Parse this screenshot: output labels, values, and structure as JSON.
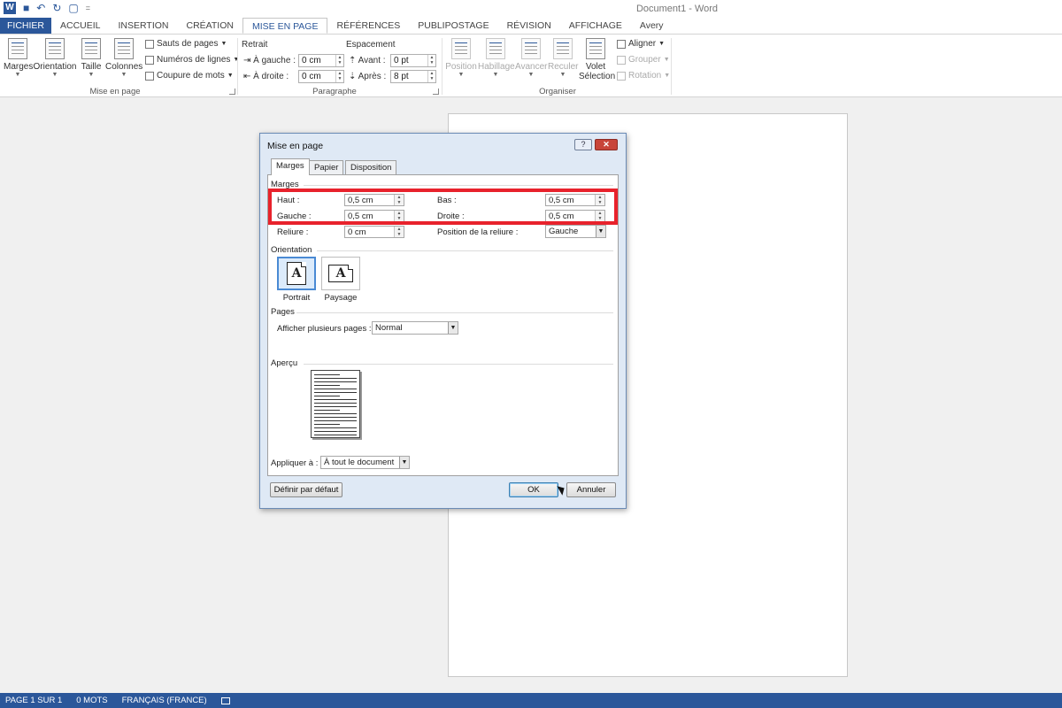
{
  "window": {
    "title": "Document1 - Word",
    "app_logo": "W"
  },
  "quick_access": {
    "save_icon": "save-icon",
    "undo_icon": "undo-icon",
    "redo_icon": "redo-icon",
    "touch_icon": "touch-mode-icon",
    "customize": "="
  },
  "tabs": [
    "FICHIER",
    "ACCUEIL",
    "INSERTION",
    "CRÉATION",
    "MISE EN PAGE",
    "RÉFÉRENCES",
    "PUBLIPOSTAGE",
    "RÉVISION",
    "AFFICHAGE",
    "Avery"
  ],
  "ribbon": {
    "mise_en_page": {
      "label": "Mise en page",
      "marges": "Marges",
      "orientation": "Orientation",
      "taille": "Taille",
      "colonnes": "Colonnes",
      "sauts": "Sauts de pages",
      "numeros": "Numéros de lignes",
      "coupure": "Coupure de mots"
    },
    "paragraphe": {
      "label": "Paragraphe",
      "retrait": "Retrait",
      "espacement": "Espacement",
      "gauche_label": "À gauche :",
      "gauche_value": "0 cm",
      "droite_label": "À droite :",
      "droite_value": "0 cm",
      "avant_label": "Avant :",
      "avant_value": "0 pt",
      "apres_label": "Après :",
      "apres_value": "8 pt"
    },
    "organiser": {
      "label": "Organiser",
      "position": "Position",
      "habillage": "Habillage",
      "avancer": "Avancer",
      "reculer": "Reculer",
      "volet_1": "Volet",
      "volet_2": "Sélection",
      "aligner": "Aligner",
      "grouper": "Grouper",
      "rotation": "Rotation"
    }
  },
  "dialog": {
    "title": "Mise en page",
    "help": "?",
    "close": "✕",
    "tabs": [
      "Marges",
      "Papier",
      "Disposition"
    ],
    "marges_section": "Marges",
    "haut_label": "Haut :",
    "haut_value": "0,5 cm",
    "bas_label": "Bas :",
    "bas_value": "0,5 cm",
    "gauche_label": "Gauche :",
    "gauche_value": "0,5 cm",
    "droite_label": "Droite :",
    "droite_value": "0,5 cm",
    "reliure_label": "Reliure :",
    "reliure_value": "0 cm",
    "position_reliure_label": "Position de la reliure :",
    "position_reliure_value": "Gauche",
    "orientation_section": "Orientation",
    "portrait": "Portrait",
    "paysage": "Paysage",
    "orientation_glyph": "A",
    "pages_section": "Pages",
    "plusieurs_pages_label": "Afficher plusieurs pages :",
    "plusieurs_pages_value": "Normal",
    "apercu_section": "Aperçu",
    "appliquer_label": "Appliquer à :",
    "appliquer_value": "À tout le document",
    "definir_defaut": "Définir par défaut",
    "ok": "OK",
    "annuler": "Annuler"
  },
  "status": {
    "page": "PAGE 1 SUR 1",
    "words": "0 MOTS",
    "language": "FRANÇAIS (FRANCE)"
  },
  "colors": {
    "accent": "#2b579a",
    "highlight": "#e8222c"
  }
}
